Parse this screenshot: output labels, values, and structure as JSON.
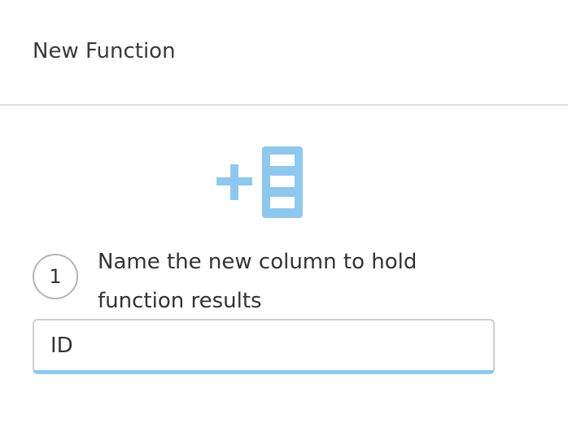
{
  "header": {
    "title": "New Function"
  },
  "icon": {
    "name": "add-column-icon",
    "color": "#8ec8ef"
  },
  "step": {
    "number": "1",
    "instruction": "Name the new column to hold function results"
  },
  "column_name_input": {
    "value": "ID"
  }
}
